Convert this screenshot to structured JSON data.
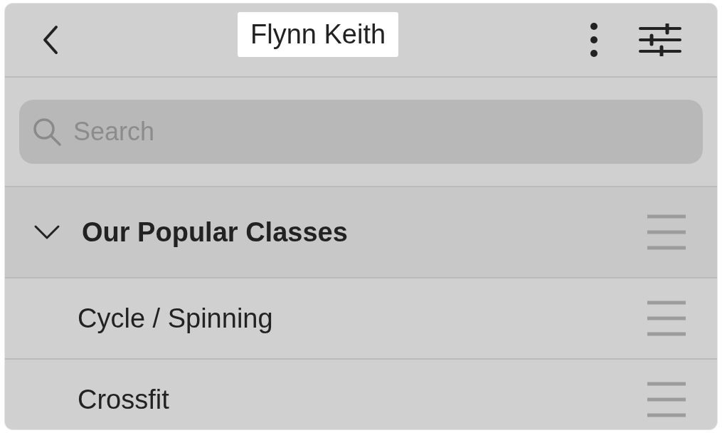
{
  "header": {
    "title": "Flynn Keith"
  },
  "search": {
    "placeholder": "Search"
  },
  "sections": [
    {
      "title": "Our Popular Classes",
      "expanded": true,
      "items": [
        {
          "label": "Cycle / Spinning"
        },
        {
          "label": "Crossfit"
        }
      ]
    }
  ]
}
